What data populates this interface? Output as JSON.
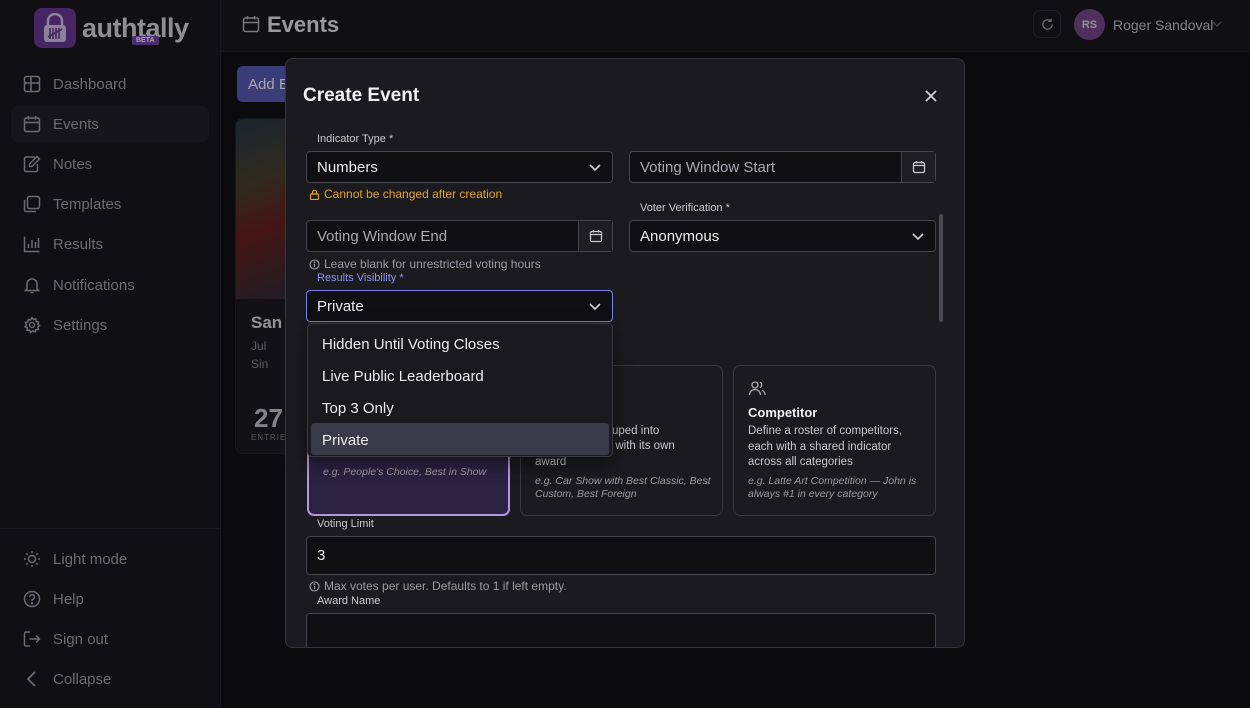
{
  "app": {
    "name": "authtally",
    "badge": "BETA"
  },
  "sidebar": {
    "items": [
      {
        "label": "Dashboard"
      },
      {
        "label": "Events"
      },
      {
        "label": "Notes"
      },
      {
        "label": "Templates"
      },
      {
        "label": "Results"
      },
      {
        "label": "Notifications"
      },
      {
        "label": "Settings"
      }
    ],
    "bottom": [
      {
        "label": "Light mode"
      },
      {
        "label": "Help"
      },
      {
        "label": "Sign out"
      },
      {
        "label": "Collapse"
      }
    ]
  },
  "header": {
    "title": "Events",
    "user": {
      "initials": "RS",
      "name": "Roger Sandoval"
    }
  },
  "background": {
    "add_button": "Add E",
    "card": {
      "title": "San A",
      "meta1": "Jul",
      "meta2": "Sin",
      "count": "27",
      "count_label": "ENTRIE"
    }
  },
  "modal": {
    "title": "Create Event",
    "indicator_type": {
      "label": "Indicator Type *",
      "value": "Numbers",
      "hint": "Cannot be changed after creation"
    },
    "voting_start": {
      "placeholder": "Voting Window Start"
    },
    "voter_verification": {
      "label": "Voter Verification *",
      "value": "Anonymous"
    },
    "voting_end": {
      "placeholder": "Voting Window End",
      "hint": "Leave blank for unrestricted voting hours"
    },
    "results_visibility": {
      "label": "Results Visibility *",
      "value": "Private",
      "options": [
        "Hidden Until Voting Closes",
        "Live Public Leaderboard",
        "Top 3 Only",
        "Private"
      ]
    },
    "event_types": [
      {
        "title": "",
        "desc": "",
        "example": "e.g. People's Choice, Best in Show"
      },
      {
        "title": "",
        "desc_line1": "uped into",
        "desc_line2": "ch with its own",
        "desc_line3": "award",
        "example": "e.g. Car Show with Best Classic, Best Custom, Best Foreign"
      },
      {
        "title": "Competitor",
        "desc": "Define a roster of competitors, each with a shared indicator across all categories",
        "example": "e.g. Latte Art Competition — John is always #1 in every category"
      }
    ],
    "voting_limit": {
      "label": "Voting Limit",
      "value": "3",
      "hint": "Max votes per user. Defaults to 1 if left empty."
    },
    "award_name": {
      "label": "Award Name"
    }
  },
  "colors": {
    "accent": "#7d80e8",
    "warning": "#e4a22a",
    "brand": "#6a3a9a"
  }
}
